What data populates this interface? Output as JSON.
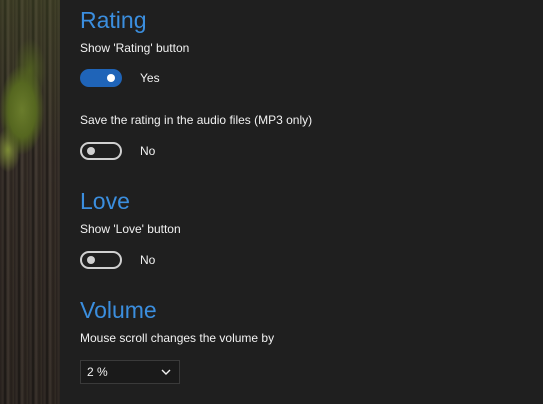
{
  "rating": {
    "title": "Rating",
    "show_button": {
      "label": "Show 'Rating' button",
      "state_text": "Yes",
      "on": true
    },
    "save_in_files": {
      "label": "Save the rating in the audio files (MP3 only)",
      "state_text": "No",
      "on": false
    }
  },
  "love": {
    "title": "Love",
    "show_button": {
      "label": "Show 'Love' button",
      "state_text": "No",
      "on": false
    }
  },
  "volume": {
    "title": "Volume",
    "scroll_label": "Mouse scroll changes the volume by",
    "step_select": {
      "value": "2 %"
    }
  },
  "icons": {
    "dropdown": "chevron-down-icon"
  },
  "colors": {
    "accent": "#3b8ede",
    "toggle_on": "#1f64b8",
    "background": "#1f1f1f"
  }
}
